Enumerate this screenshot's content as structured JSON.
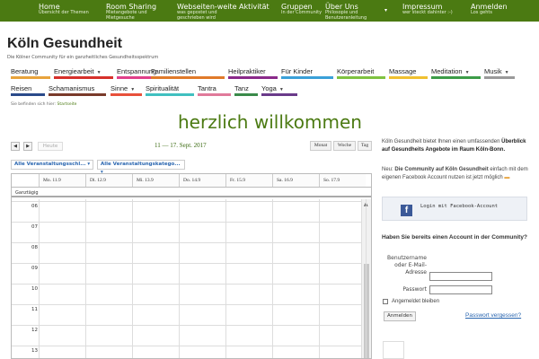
{
  "topnav": [
    {
      "title": "Home",
      "sub": [
        "Übersicht der Themen"
      ]
    },
    {
      "title": "Room Sharing",
      "sub": [
        "Mietangebote und",
        "Mietgesuche"
      ]
    },
    {
      "title": "Webseiten-weite Aktivität",
      "sub": [
        "was gepostet und",
        "geschrieben wird"
      ]
    },
    {
      "title": "Gruppen",
      "sub": [
        "In der Community"
      ]
    },
    {
      "title": "Über Uns",
      "sub": [
        "Philosopie und",
        "Benutzeranleitung"
      ]
    },
    {
      "title": "Impressum",
      "sub": [
        "wer steckt dahinter :-)"
      ]
    },
    {
      "title": "Anmelden",
      "sub": [
        "Los gehts"
      ]
    }
  ],
  "site": {
    "title": "Köln Gesundheit",
    "tagline": "Die Kölner Community für ein ganzheitliches Gesundheitsspektrum"
  },
  "nav_row1": [
    {
      "label": "Beratung",
      "color": "#e8a33c",
      "dropdown": false
    },
    {
      "label": "Energiearbeit",
      "color": "#d6302b",
      "dropdown": true
    },
    {
      "label": "Entspannung",
      "color": "#e0408a",
      "dropdown": false
    },
    {
      "label": "Familienstellen",
      "color": "#e07a2a",
      "dropdown": false
    },
    {
      "label": "Heilpraktiker",
      "color": "#8a2a8a",
      "dropdown": false
    },
    {
      "label": "Für Kinder",
      "color": "#3aa0d8",
      "dropdown": false
    },
    {
      "label": "Körperarbeit",
      "color": "#7fc241",
      "dropdown": false
    },
    {
      "label": "Massage",
      "color": "#f0c030",
      "dropdown": false
    },
    {
      "label": "Meditation",
      "color": "#3c9c48",
      "dropdown": true
    },
    {
      "label": "Musik",
      "color": "#9a9a9a",
      "dropdown": true
    }
  ],
  "nav_row2": [
    {
      "label": "Reisen",
      "color": "#2a4a8a",
      "dropdown": false
    },
    {
      "label": "Schamanismus",
      "color": "#7a3a2a",
      "dropdown": false
    },
    {
      "label": "Sinne",
      "color": "#e8503a",
      "dropdown": true
    },
    {
      "label": "Spiritualität",
      "color": "#40c0c0",
      "dropdown": false
    },
    {
      "label": "Tantra",
      "color": "#e07a9a",
      "dropdown": false
    },
    {
      "label": "Tanz",
      "color": "#3a8a4a",
      "dropdown": false
    },
    {
      "label": "Yoga",
      "color": "#6a3a8a",
      "dropdown": true
    }
  ],
  "breadcrumb": {
    "prefix": "Sie befinden sich hier:",
    "current": "Startseite"
  },
  "welcome": "herzlich willkommen",
  "calendar": {
    "prev_icon": "◀",
    "next_icon": "▶",
    "today_label": "Heute",
    "range": "11 — 17. Sept. 2017",
    "views": [
      "Monat",
      "Woche",
      "Tag"
    ],
    "filters": [
      "Alle Veranstaltungsschl...",
      "Alle Veranstaltungskatego..."
    ],
    "days": [
      "Mo. 11.9",
      "Di. 12.9",
      "Mi. 13.9",
      "Do. 14.9",
      "Fr. 15.9",
      "Sa. 16.9",
      "So. 17.9"
    ],
    "allday_label": "Ganztägig",
    "hours": [
      "06",
      "07",
      "08",
      "09",
      "10",
      "11",
      "12",
      "13"
    ]
  },
  "sidebar": {
    "intro_pre": "Köln Gesundheit bietet Ihnen einen umfassenden",
    "intro_bold": "Überblick auf Gesundheits Angebote im Raum Köln-Bonn.",
    "neu_prefix": "Neu:",
    "neu_bold": "Die Community auf Köln Gesundheit",
    "neu_rest": "einfach mit dem eigenen Facebook Account  nutzen ist jetzt möglich",
    "neu_mark": "▬",
    "fb_letter": "f",
    "fb_label": "Login mit Facebook-Account",
    "question": "Haben Sie bereits einen Account in der Community?",
    "user_label": "Benutzername oder E-Mail-Adresse",
    "password_label": "Passwort",
    "remember_label": "Angemeldet bleiben",
    "login_button": "Anmelden",
    "forgot_link": "Passwort vergessen?"
  }
}
